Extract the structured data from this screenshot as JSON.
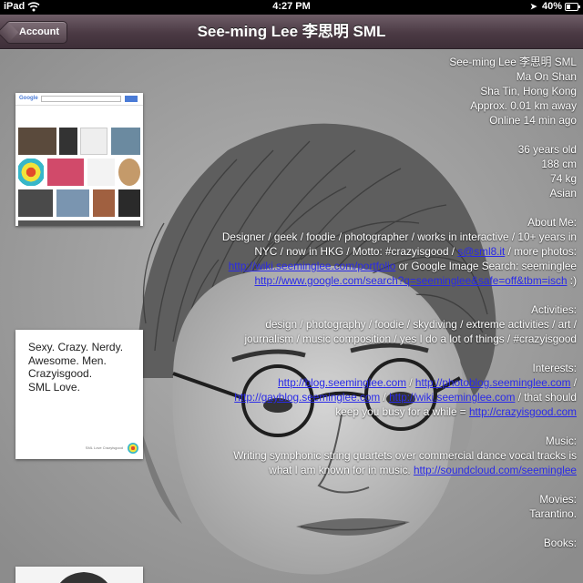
{
  "status_bar": {
    "device": "iPad",
    "time": "4:27 PM",
    "battery_percent": "40%",
    "battery_level": 0.4,
    "icons": [
      "wifi-icon",
      "location-arrow-icon",
      "battery-icon"
    ]
  },
  "nav": {
    "back_label": "Account",
    "title": "See-ming Lee 李思明 SML"
  },
  "thumbnails": {
    "google": {
      "logo": "Google"
    },
    "quote": {
      "text": "Sexy. Crazy. Nerdy.\nAwesome. Men.\nCrazyisgood.\nSML Love.",
      "footer": "SML Love Crazyisgood"
    }
  },
  "profile": {
    "name": "See-ming Lee 李思明 SML",
    "area": "Ma On Shan",
    "region": "Sha Tin, Hong Kong",
    "distance": "Approx. 0.01 km away",
    "online": "Online 14 min ago",
    "age": "36 years old",
    "height": "188 cm",
    "weight": "74 kg",
    "ethnicity": "Asian",
    "about": {
      "title": "About Me:",
      "text1": "Designer / geek / foodie / photographer / works in interactive / 10+ years in NYC / now in HKG / Motto: #crazyisgood / ",
      "link1": "s@sml8.it",
      "text2": " / more photos: ",
      "link2": "http://wiki.seeminglee.com/portfolio",
      "text3": " or Google Image Search: seeminglee ",
      "link3": "http://www.google.com/search?q=seeminglee&safe=off&tbm=isch",
      "text4": " :)"
    },
    "activities": {
      "title": "Activities:",
      "text": "design / photography / foodie / skydiving / extreme activities / art / journalism / music composition / yes I do a lot of things / #crazyisgood"
    },
    "interests": {
      "title": "Interests:",
      "link1": "http://blog.seeminglee.com",
      "sep1": " / ",
      "link2": "http://photoblog.seeminglee.com",
      "sep2": " / ",
      "link3": "http://gayblog.seeminglee.com",
      "sep3": " / ",
      "link4": "http://wiki.seeminglee.com",
      "text": " / that should keep you busy for a while = ",
      "link5": "http://crazyisgood.com"
    },
    "music": {
      "title": "Music:",
      "text": "Writing symphonic string quartets over commercial dance vocal tracks is what I am known for in music. ",
      "link": "http://soundcloud.com/seeminglee"
    },
    "movies": {
      "title": "Movies:",
      "text": "Tarantino."
    },
    "books": {
      "title": "Books:"
    }
  },
  "colors": {
    "nav_bar": "#4b3a44",
    "link": "#2a2ae8",
    "background": "#9a9a9a"
  }
}
